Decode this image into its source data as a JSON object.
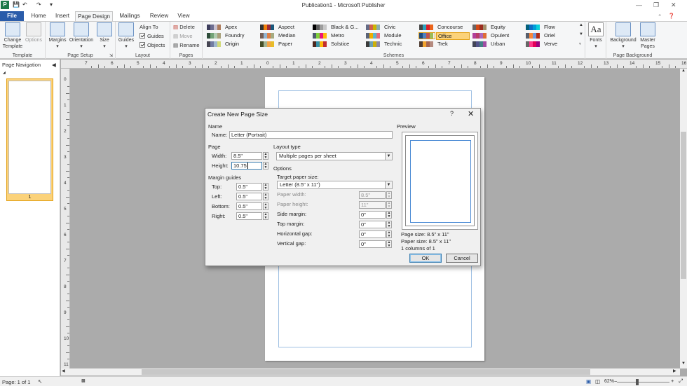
{
  "app": {
    "title": "Publication1 - Microsoft Publisher",
    "icon_letter": "P"
  },
  "tabs": [
    "File",
    "Home",
    "Insert",
    "Page Design",
    "Mailings",
    "Review",
    "View"
  ],
  "active_tab": "Page Design",
  "ribbon": {
    "template": {
      "change_template": "Change Template",
      "options": "Options",
      "group_label": "Template"
    },
    "page_setup": {
      "margins": "Margins",
      "orientation": "Orientation",
      "size": "Size",
      "group_label": "Page Setup"
    },
    "layout": {
      "guides": "Guides",
      "align_to": "Align To",
      "guides_check": "Guides",
      "objects_check": "Objects",
      "group_label": "Layout"
    },
    "pages": {
      "delete": "Delete",
      "move": "Move",
      "rename": "Rename",
      "group_label": "Pages"
    },
    "schemes": {
      "group_label": "Schemes",
      "selected": "Office",
      "items": [
        {
          "name": "Apex",
          "colors": [
            "#3d3d5c",
            "#6e6e91",
            "#c9c2d0",
            "#ad7b5c"
          ]
        },
        {
          "name": "Foundry",
          "colors": [
            "#2e4d3a",
            "#72a376",
            "#b0ccb0",
            "#a8a07a"
          ]
        },
        {
          "name": "Origin",
          "colors": [
            "#464653",
            "#727ca3",
            "#9fb8cd",
            "#d2da7a"
          ]
        },
        {
          "name": "Aspect",
          "colors": [
            "#323232",
            "#f07f09",
            "#9f2936",
            "#1b587c"
          ]
        },
        {
          "name": "Median",
          "colors": [
            "#775f55",
            "#94b6d2",
            "#dd8047",
            "#a5ab81"
          ]
        },
        {
          "name": "Paper",
          "colors": [
            "#444d26",
            "#a5b592",
            "#f3a447",
            "#e7bc29"
          ]
        },
        {
          "name": "Black & G...",
          "colors": [
            "#000000",
            "#5c5c5c",
            "#9d9d9d",
            "#c8c8c8"
          ]
        },
        {
          "name": "Metro",
          "colors": [
            "#4e5b6f",
            "#7fd13b",
            "#ea157a",
            "#feb80a"
          ]
        },
        {
          "name": "Solstice",
          "colors": [
            "#4f271c",
            "#3891a7",
            "#feb80a",
            "#c32d2e"
          ]
        },
        {
          "name": "Civic",
          "colors": [
            "#646b86",
            "#d16349",
            "#ccb400",
            "#8cadae"
          ]
        },
        {
          "name": "Module",
          "colors": [
            "#5a6378",
            "#f0ad00",
            "#60b5cc",
            "#e66c7d"
          ]
        },
        {
          "name": "Technic",
          "colors": [
            "#3b3b3b",
            "#6ea0b0",
            "#ccaf0a",
            "#8d89a4"
          ]
        },
        {
          "name": "Concourse",
          "colors": [
            "#464646",
            "#2da2bf",
            "#da1f28",
            "#eb641b"
          ]
        },
        {
          "name": "Office",
          "colors": [
            "#1f497d",
            "#4f81bd",
            "#c0504d",
            "#9bbb59"
          ]
        },
        {
          "name": "Trek",
          "colors": [
            "#4e3b30",
            "#f0a22e",
            "#a5644e",
            "#b58b80"
          ]
        },
        {
          "name": "Equity",
          "colors": [
            "#696464",
            "#d34817",
            "#9b2d1f",
            "#a28e6a"
          ]
        },
        {
          "name": "Opulent",
          "colors": [
            "#b13f9a",
            "#b83d68",
            "#ac66bb",
            "#de6c36"
          ]
        },
        {
          "name": "Urban",
          "colors": [
            "#424456",
            "#53548a",
            "#438086",
            "#a04da3"
          ]
        },
        {
          "name": "Flow",
          "colors": [
            "#04617b",
            "#0f6fc6",
            "#009dd9",
            "#0bd0d9"
          ]
        },
        {
          "name": "Oriel",
          "colors": [
            "#575f6d",
            "#fe8637",
            "#7598d9",
            "#b32c16"
          ]
        },
        {
          "name": "Verve",
          "colors": [
            "#666666",
            "#ff388c",
            "#e40059",
            "#9c007f"
          ]
        }
      ]
    },
    "fonts": {
      "label": "Fonts",
      "glyph": "Aa"
    },
    "page_background": {
      "background": "Background",
      "master_pages": "Master Pages",
      "group_label": "Page Background"
    }
  },
  "page_nav": {
    "title": "Page Navigation",
    "page_number": "1"
  },
  "ruler": {
    "h_numbers": [
      "7",
      "6",
      "5",
      "4",
      "3",
      "2",
      "1",
      "0",
      "1",
      "2",
      "3",
      "4",
      "5",
      "6",
      "7",
      "8",
      "9",
      "10",
      "11",
      "12",
      "13",
      "14",
      "15",
      "16"
    ],
    "v_numbers": [
      "0",
      "1",
      "2",
      "3",
      "4",
      "5",
      "6",
      "7",
      "8",
      "9",
      "10",
      "11"
    ]
  },
  "status": {
    "page_text": "Page: 1 of 1",
    "zoom": "62%"
  },
  "dialog": {
    "title": "Create New Page Size",
    "name_section": "Name",
    "name_label": "Name:",
    "name_value": "Letter (Portrait)",
    "page_section": "Page",
    "width_label": "Width:",
    "width_value": "8.5\"",
    "height_label": "Height:",
    "height_value": "10.75",
    "margin_section": "Margin guides",
    "top_label": "Top:",
    "top_value": "0.5\"",
    "left_label": "Left:",
    "left_value": "0.5\"",
    "bottom_label": "Bottom:",
    "bottom_value": "0.5\"",
    "right_label": "Right:",
    "right_value": "0.5\"",
    "layout_label": "Layout type",
    "layout_value": "Multiple pages per sheet",
    "options_label": "Options",
    "target_label": "Target paper size:",
    "target_value": "Letter (8.5\" x 11\")",
    "paper_width_label": "Paper width:",
    "paper_width_value": "8.5\"",
    "paper_height_label": "Paper height:",
    "paper_height_value": "11\"",
    "side_margin_label": "Side margin:",
    "side_margin_value": "0\"",
    "top_margin_label": "Top margin:",
    "top_margin_value": "0\"",
    "h_gap_label": "Horizontal gap:",
    "h_gap_value": "0\"",
    "v_gap_label": "Vertical gap:",
    "v_gap_value": "0\"",
    "preview_label": "Preview",
    "page_size_text": "Page size: 8.5\" x 11\"",
    "paper_size_text": "Paper size: 8.5\" x 11\"",
    "columns_text": "1 columns of 1",
    "ok": "OK",
    "cancel": "Cancel"
  }
}
